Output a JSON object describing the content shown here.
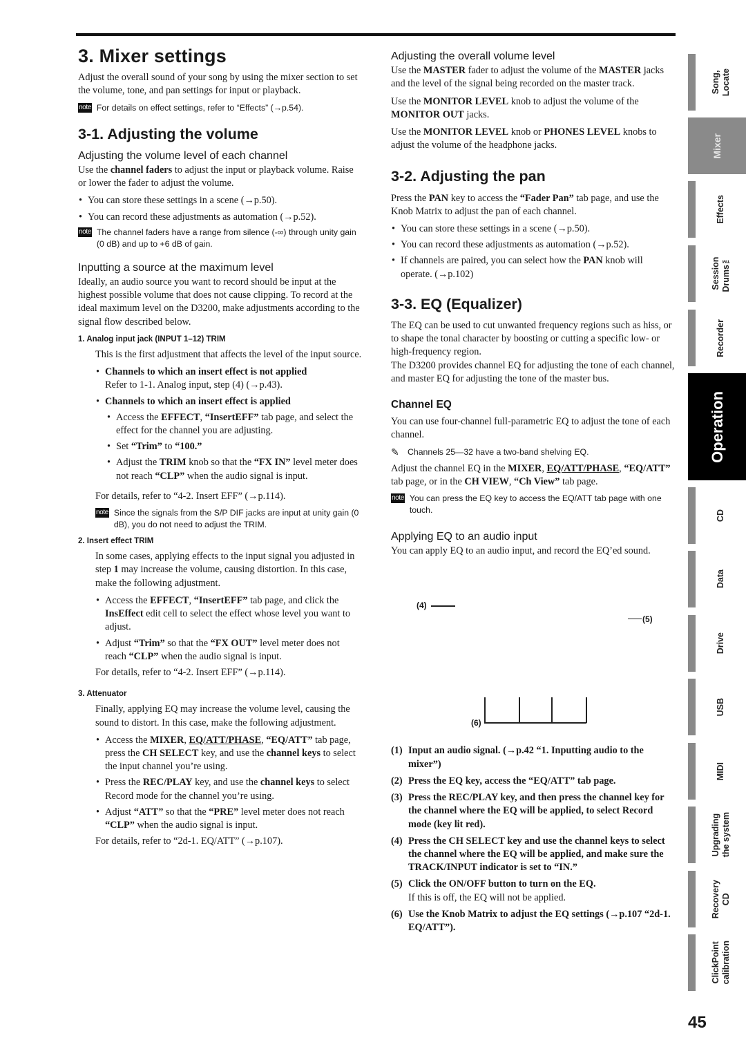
{
  "page": {
    "number": "45"
  },
  "left": {
    "title": "3. Mixer settings",
    "intro": "Adjust the overall sound of your song by using the mixer section to set the volume, tone, and pan settings for input or playback.",
    "intro_note": "For details on effect settings, refer to “Effects” (→p.54).",
    "section_1_title": "3-1. Adjusting the volume",
    "sub_channel": {
      "heading": "Adjusting the volume level of each channel",
      "para_pre": "Use the ",
      "para_bold": "channel faders",
      "para_post": " to adjust the input or playback volume. Raise or lower the fader to adjust the volume.",
      "bullets": [
        "You can store these settings in a scene (→p.50).",
        "You can record these adjustments as automation (→p.52)."
      ],
      "note": "The channel faders have a range from silence (-∞) through unity gain (0 dB) and up to +6 dB of gain."
    },
    "sub_max": {
      "heading": "Inputting a source at the maximum level",
      "para": "Ideally, an audio source you want to record should be input at the highest possible volume that does not cause clipping. To record at the ideal maximum level on the D3200, make adjustments according to the signal flow described below."
    },
    "step1": {
      "heading": "1. Analog input jack (INPUT 1–12) TRIM",
      "para": "This is the first adjustment that affects the level of the input source.",
      "case_a_title": "Channels to which an insert effect is not applied",
      "case_a_text": "Refer to 1-1. Analog input, step (4) (→p.43).",
      "case_b_title": "Channels to which an insert effect is applied",
      "case_b_items": [
        {
          "t1": "Access the ",
          "b1": "EFFECT",
          "t2": ", ",
          "b2": "“InsertEFF”",
          "t3": " tab page, and select the effect for the channel you are adjusting."
        },
        {
          "t1": "Set ",
          "b1": "“Trim”",
          "t2": " to ",
          "b2": "“100.”",
          "t3": ""
        },
        {
          "t1": "Adjust the ",
          "b1": "TRIM",
          "t2": " knob so that the ",
          "b2": "“FX IN”",
          "t3": " level meter does not reach ",
          "b3": "“CLP”",
          "t4": " when the audio signal is input."
        }
      ],
      "details": "For details, refer to “4-2. Insert EFF” (→p.114).",
      "note": "Since the signals from the S/P DIF jacks are input at unity gain (0 dB), you do not need to adjust the TRIM."
    },
    "step2": {
      "heading": "2. Insert effect TRIM",
      "para_pre": "In some cases, applying effects to the input signal you adjusted in step ",
      "para_bold": "1",
      "para_post": " may increase the volume, causing distortion. In this case, make the following adjustment.",
      "items": [
        {
          "t1": "Access the ",
          "b1": "EFFECT",
          "t2": ", ",
          "b2": "“InsertEFF”",
          "t3": " tab page, and click the ",
          "b3": "InsEffect",
          "t4": " edit cell to select the effect whose level you want to adjust."
        },
        {
          "t1": "Adjust ",
          "b1": "“Trim”",
          "t2": " so that the ",
          "b2": "“FX OUT”",
          "t3": " level meter does not reach ",
          "b3": "“CLP”",
          "t4": " when the audio signal is input."
        }
      ],
      "details": "For details, refer to “4-2. Insert EFF” (→p.114)."
    },
    "step3": {
      "heading": "3. Attenuator",
      "para": "Finally, applying EQ may increase the volume level, causing the sound to distort. In this case, make the following adjustment.",
      "item1": {
        "t1": "Access the ",
        "b1": "MIXER",
        "t2": ", ",
        "u1": "EQ/ATT/PHASE",
        "t3": ", ",
        "b2": "“EQ/ATT”",
        "t4": " tab page, press the ",
        "b3": "CH SELECT",
        "t5": " key, and use the ",
        "b4": "channel keys",
        "t6": " to select the input channel you’re using."
      },
      "item2": {
        "t1": "Press the ",
        "b1": "REC/PLAY",
        "t2": " key, and use the ",
        "b2": "channel keys",
        "t3": " to select Record mode for the channel you’re using."
      },
      "item3": {
        "t1": "Adjust ",
        "b1": "“ATT”",
        "t2": " so that the ",
        "b2": "“PRE”",
        "t3": " level meter does not reach ",
        "b3": "“CLP”",
        "t4": " when the audio signal is input."
      },
      "details": "For details, refer to “2d-1. EQ/ATT” (→p.107)."
    }
  },
  "right": {
    "overall": {
      "heading": "Adjusting the overall volume level",
      "p1": {
        "t1": "Use the ",
        "b1": "MASTER",
        "t2": " fader to adjust the volume of the ",
        "b2": "MASTER",
        "t3": " jacks and the level of the signal being recorded on the master track."
      },
      "p2": {
        "t1": "Use the ",
        "b1": "MONITOR LEVEL",
        "t2": " knob to adjust the volume of the ",
        "b2": "MONITOR OUT",
        "t3": " jacks."
      },
      "p3": {
        "t1": "Use the ",
        "b1": "MONITOR LEVEL",
        "t2": " knob or ",
        "b2": "PHONES LEVEL",
        "t3": " knobs to adjust the volume of the headphone jacks."
      }
    },
    "pan": {
      "title": "3-2. Adjusting the pan",
      "para": {
        "t1": "Press the ",
        "b1": "PAN",
        "t2": " key to access the ",
        "b2": "“Fader Pan”",
        "t3": " tab page, and use the Knob Matrix to adjust the pan of each channel."
      },
      "bullets": [
        "You can store these settings in a scene (→p.50).",
        "You can record these adjustments as automation (→p.52)."
      ],
      "bullet3": {
        "t1": "If channels are paired, you can select how the ",
        "b1": "PAN",
        "t2": " knob will operate. (→p.102)"
      }
    },
    "eq": {
      "title": "3-3. EQ (Equalizer)",
      "p1": "The EQ can be used to cut unwanted frequency regions such as hiss, or to shape the tonal character by boosting or cutting a specific low- or high-frequency region.",
      "p2": "The D3200 provides channel EQ for adjusting the tone of each channel, and master EQ for adjusting the tone of the master bus.",
      "channel_eq_heading": "Channel EQ",
      "channel_eq_para": "You can use four-channel full-parametric EQ to adjust the tone of each channel.",
      "tip": "Channels 25—32 have a two-band shelving EQ.",
      "adjust": {
        "t1": "Adjust the channel EQ in the ",
        "b1": "MIXER",
        "t2": ", ",
        "u1": "EQ/ATT/PHASE",
        "t3": ", ",
        "b2": "“EQ/ATT”",
        "t4": " tab page, or in the ",
        "b3": "CH VIEW",
        "t5": ", ",
        "b4": "“Ch View”",
        "t6": " tab page."
      },
      "note": "You can press the EQ key to access the EQ/ATT tab page with one touch.",
      "apply_heading": "Applying EQ to an audio input",
      "apply_para": "You can apply EQ to an audio input, and record the EQ’ed sound.",
      "diagram_labels": {
        "l4": "(4)",
        "l5": "(5)",
        "l6": "(6)"
      },
      "steps": [
        {
          "num": "(1)",
          "text": "Input an audio signal. (→p.42 “1. Inputting audio to the mixer”)"
        },
        {
          "num": "(2)",
          "text": "Press the EQ key, access the “EQ/ATT” tab page."
        },
        {
          "num": "(3)",
          "text": "Press the REC/PLAY key, and then press the channel key for the channel where the EQ will be applied, to select Record mode (key lit red)."
        },
        {
          "num": "(4)",
          "text": "Press the CH SELECT key and use the channel keys to select the channel where the EQ will be applied, and make sure the TRACK/INPUT indicator is set to “IN.”"
        },
        {
          "num": "(5)",
          "text": "Click the ON/OFF button to turn on the EQ.",
          "sub": "If this is off, the EQ will not be applied."
        },
        {
          "num": "(6)",
          "text": "Use the Knob Matrix to adjust the EQ settings (→p.107 “2d-1. EQ/ATT”)."
        }
      ]
    }
  },
  "side_tabs": [
    {
      "label": "Song,\nLocate",
      "state": "normal"
    },
    {
      "label": "Mixer",
      "state": "current"
    },
    {
      "label": "Effects",
      "state": "normal"
    },
    {
      "label": "Session\nDrums™",
      "state": "normal"
    },
    {
      "label": "Recorder",
      "state": "normal"
    },
    {
      "label": "Operation",
      "state": "section"
    },
    {
      "label": "CD",
      "state": "normal"
    },
    {
      "label": "Data",
      "state": "normal"
    },
    {
      "label": "Drive",
      "state": "normal"
    },
    {
      "label": "USB",
      "state": "normal"
    },
    {
      "label": "MIDI",
      "state": "normal"
    },
    {
      "label": "Upgrading\nthe system",
      "state": "normal"
    },
    {
      "label": "Recovery\nCD",
      "state": "normal"
    },
    {
      "label": "ClickPoint\ncalibration",
      "state": "normal"
    }
  ],
  "icons": {
    "note_label": "note",
    "pencil": "✎"
  }
}
